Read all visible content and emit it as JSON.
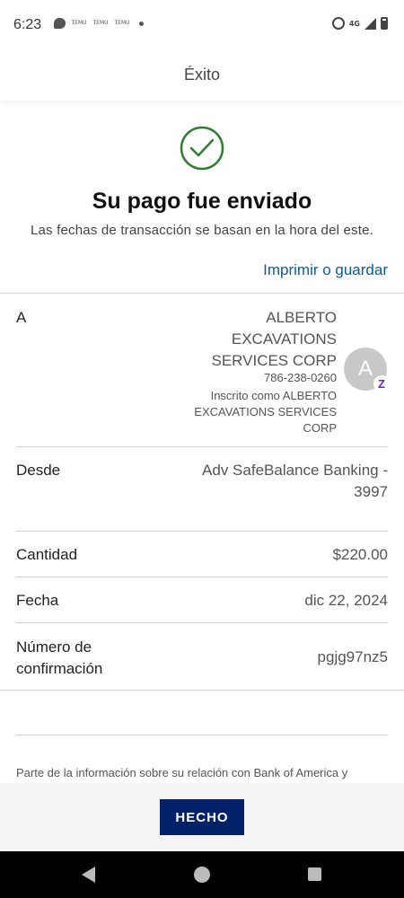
{
  "status_bar": {
    "time": "6:23",
    "temu_labels": [
      "TEMU",
      "TEMU",
      "TEMU"
    ],
    "network": "4G"
  },
  "header": {
    "title": "Éxito"
  },
  "success": {
    "icon": "check-circle-icon",
    "headline": "Su pago fue enviado",
    "subtitle": "Las fechas de transacción se basan en la hora del este.",
    "print_link": "Imprimir o guardar"
  },
  "details": {
    "to": {
      "label": "A",
      "name": "ALBERTO EXCAVATIONS SERVICES CORP",
      "phone": "786-238-0260",
      "enrolled": "Inscrito como ALBERTO EXCAVATIONS SERVICES CORP",
      "avatar_initial": "A",
      "badge": "Z"
    },
    "from": {
      "label": "Desde",
      "value": "Adv SafeBalance Banking - 3997"
    },
    "amount": {
      "label": "Cantidad",
      "value": "$220.00"
    },
    "date": {
      "label": "Fecha",
      "value": "dic 22, 2024"
    },
    "confirmation": {
      "label": "Número de confirmación",
      "value": "pgjg97nz5"
    }
  },
  "disclaimer": "Parte de la información sobre su relación con Bank of America y",
  "footer": {
    "done_label": "HECHO"
  },
  "colors": {
    "accent_blue": "#012169",
    "link_blue": "#0b5a9c",
    "success_green": "#2e7d32",
    "zelle_purple": "#6d1ed4"
  }
}
